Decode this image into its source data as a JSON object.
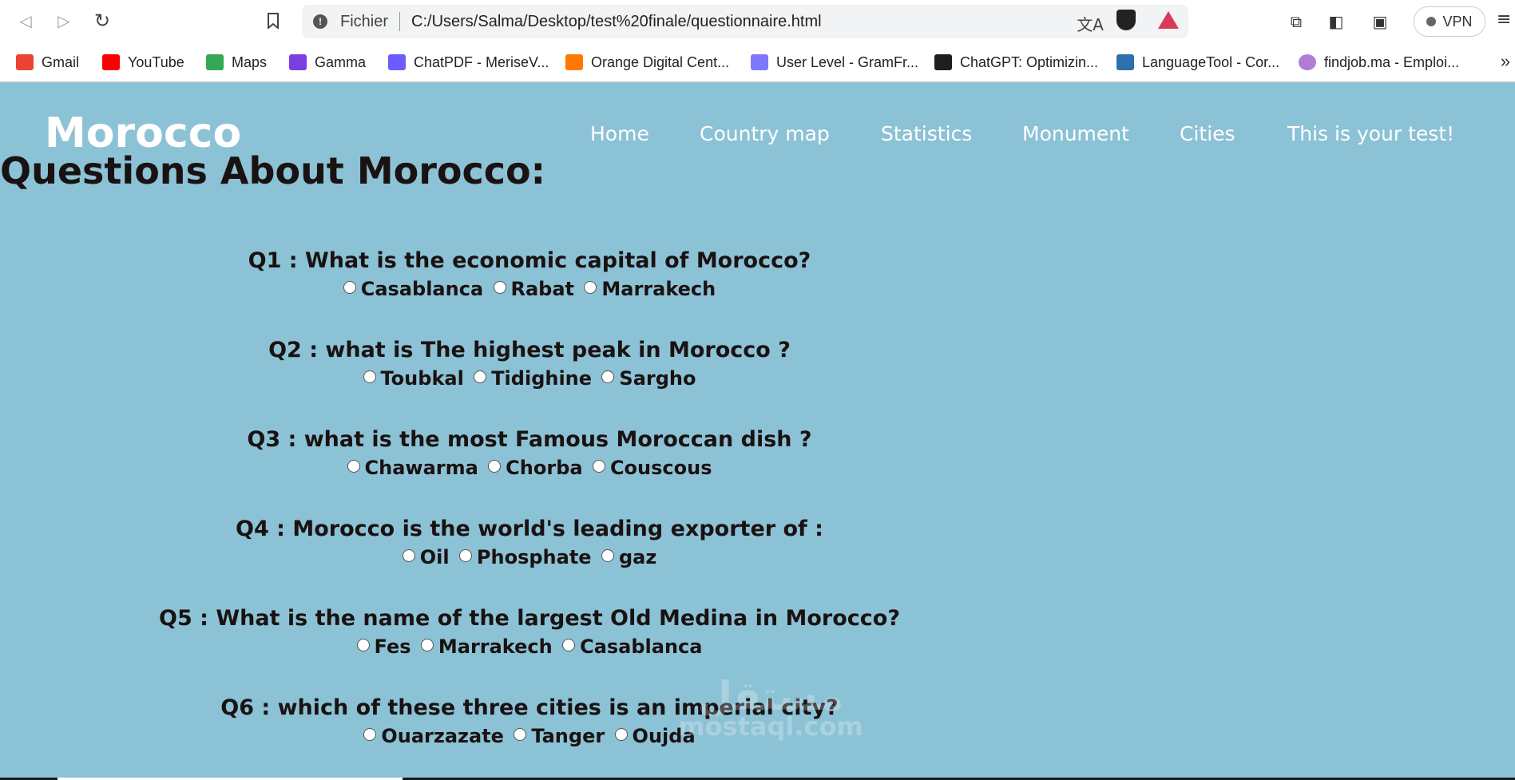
{
  "browser": {
    "url_scheme": "Fichier",
    "url": "C:/Users/Salma/Desktop/test%20finale/questionnaire.html",
    "vpn_label": "VPN",
    "translate_glyph": "文A",
    "info_glyph": "!",
    "icons": {
      "back": "◁",
      "forward": "▷",
      "reload": "↻",
      "bookmark": "🔖",
      "extensions": "⧉",
      "sidebar": "◧",
      "wallet": "▣",
      "menu": "≡",
      "more": "»"
    }
  },
  "bookmarks": [
    {
      "label": "Gmail",
      "icon": "gmail-icon",
      "color": "#ea4335"
    },
    {
      "label": "YouTube",
      "icon": "youtube-icon",
      "color": "#ff0000"
    },
    {
      "label": "Maps",
      "icon": "maps-icon",
      "color": "#34a853"
    },
    {
      "label": "Gamma",
      "icon": "gamma-icon",
      "color": "#7b3fe4"
    },
    {
      "label": "ChatPDF - MeriseV...",
      "icon": "chatpdf-icon",
      "color": "#6a5cff"
    },
    {
      "label": "Orange Digital Cent...",
      "icon": "orange-icon",
      "color": "#ff7900"
    },
    {
      "label": "User Level - GramFr...",
      "icon": "heart-icon",
      "color": "#7e78ff"
    },
    {
      "label": "ChatGPT: Optimizin...",
      "icon": "chatgpt-icon",
      "color": "#1e1e1e"
    },
    {
      "label": "LanguageTool - Cor...",
      "icon": "languagetool-icon",
      "color": "#2e6fb0"
    },
    {
      "label": "findjob.ma - Emploi...",
      "icon": "findjob-icon",
      "color": "#b07cd8"
    }
  ],
  "site": {
    "logo": "Morocco",
    "nav": [
      "Home",
      "Country map",
      "Statistics",
      "Monument",
      "Cities",
      "This is your test!"
    ],
    "page_title": "Questions About Morocco:"
  },
  "questions": [
    {
      "text": "Q1 : What is the economic capital of Morocco?",
      "options": [
        "Casablanca",
        "Rabat",
        "Marrakech"
      ]
    },
    {
      "text": "Q2 : what is The highest peak in Morocco ?",
      "options": [
        "Toubkal",
        "Tidighine",
        "Sargho"
      ]
    },
    {
      "text": "Q3 : what is the most Famous Moroccan dish ?",
      "options": [
        "Chawarma",
        "Chorba",
        "Couscous"
      ]
    },
    {
      "text": "Q4 : Morocco is the world's leading exporter of :",
      "options": [
        "Oil",
        "Phosphate",
        "gaz"
      ]
    },
    {
      "text": "Q5 : What is the name of the largest Old Medina in Morocco?",
      "options": [
        "Fes",
        "Marrakech",
        "Casablanca"
      ]
    },
    {
      "text": "Q6 : which of these three cities is an imperial city?",
      "options": [
        "Ouarzazate",
        "Tanger",
        "Oujda"
      ]
    }
  ],
  "watermark": {
    "arabic": "مستقل",
    "latin": "mostaql.com"
  },
  "colors": {
    "background": "#8cc2d5",
    "text": "#1a1212",
    "nav": "#ffffff"
  }
}
